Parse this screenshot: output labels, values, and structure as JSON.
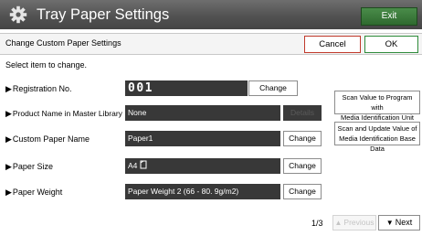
{
  "header": {
    "title": "Tray Paper Settings",
    "icon": "gear-icon",
    "exit_label": "Exit",
    "exit_color": "#3a7a3a"
  },
  "subheader": {
    "label": "Change Custom Paper Settings",
    "cancel_label": "Cancel",
    "ok_label": "OK",
    "cancel_border_color": "#c0392b",
    "ok_border_color": "#2e8b3a"
  },
  "prompt": "Select item to change.",
  "rows": [
    {
      "arrow": "▶",
      "label": "Registration No.",
      "value": "001",
      "button": "Change",
      "button_enabled": true
    },
    {
      "arrow": "▶",
      "label": "Product Name in Master Library",
      "value": "None",
      "button": "Details",
      "button_enabled": false
    },
    {
      "arrow": "▶",
      "label": "Custom Paper Name",
      "value": "Paper1",
      "button": "Change",
      "button_enabled": true
    },
    {
      "arrow": "▶",
      "label": "Paper Size",
      "value": "A4",
      "value_icon": "portrait-orientation-icon",
      "button": "Change",
      "button_enabled": true
    },
    {
      "arrow": "▶",
      "label": "Paper Weight",
      "value": "Paper Weight 2 (66 - 80. 9g/m2)",
      "button": "Change",
      "button_enabled": true
    }
  ],
  "side_buttons": [
    {
      "line1": "Scan Value to Program with",
      "line2": "Media Identification Unit"
    },
    {
      "line1": "Scan and Update Value of",
      "line2": "Media Identification Base Data"
    }
  ],
  "pagination": {
    "page": "1/3",
    "prev_label": "Previous",
    "next_label": "Next",
    "prev_enabled": false,
    "next_enabled": true
  }
}
